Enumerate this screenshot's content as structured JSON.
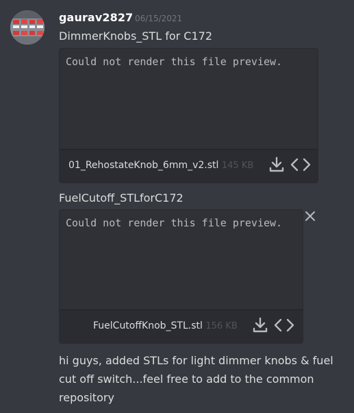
{
  "message": {
    "username": "gaurav2827",
    "timestamp": "06/15/2021",
    "title1": "DimmerKnobs_STL for C172",
    "title2": "FuelCutoff_STLforC172",
    "body": "hi guys, added STLs for light dimmer knobs & fuel cut off switch...feel free to add to the common repository"
  },
  "attachments": [
    {
      "preview_text": "Could not render this file preview.",
      "filename": "01_RehostateKnob_6mm_v2.stl",
      "size": "145 KB",
      "download_icon": "download-icon",
      "code_icon": "code-view-icon"
    },
    {
      "preview_text": "Could not render this file preview.",
      "filename": "FuelCutoffKnob_STL.stl",
      "size": "156 KB",
      "download_icon": "download-icon",
      "code_icon": "code-view-icon",
      "close_icon": "close-icon"
    }
  ],
  "colors": {
    "background": "#36393f",
    "attachment_bg": "#2f3136",
    "username": "#ffffff",
    "text": "#dcddde",
    "muted": "#72767d"
  }
}
